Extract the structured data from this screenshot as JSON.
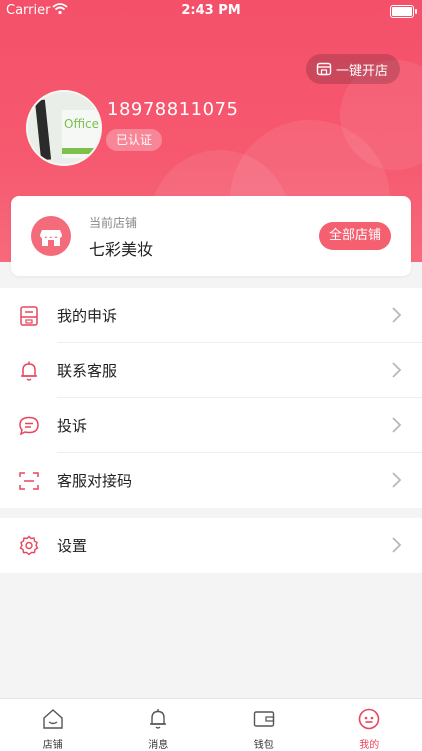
{
  "status_bar": {
    "carrier": "Carrier",
    "time": "2:43 PM"
  },
  "header": {
    "open_shop_label": "一键开店",
    "phone": "18978811075",
    "verified_label": "已认证",
    "avatar_text": "Office"
  },
  "shop_card": {
    "label": "当前店铺",
    "name": "七彩美妆",
    "all_shops_label": "全部店铺"
  },
  "menu": {
    "items": [
      {
        "label": "我的申诉",
        "icon": "appeal-icon"
      },
      {
        "label": "联系客服",
        "icon": "bell-icon"
      },
      {
        "label": "投诉",
        "icon": "chat-icon"
      },
      {
        "label": "客服对接码",
        "icon": "scan-icon"
      }
    ],
    "settings": {
      "label": "设置",
      "icon": "gear-icon"
    }
  },
  "tabbar": {
    "tabs": [
      {
        "label": "店铺",
        "icon": "home-icon"
      },
      {
        "label": "消息",
        "icon": "bell-icon"
      },
      {
        "label": "钱包",
        "icon": "wallet-icon"
      },
      {
        "label": "我的",
        "icon": "profile-icon"
      }
    ],
    "active_index": 3
  },
  "colors": {
    "primary": "#f4506a",
    "active_tab": "#e8455d"
  }
}
